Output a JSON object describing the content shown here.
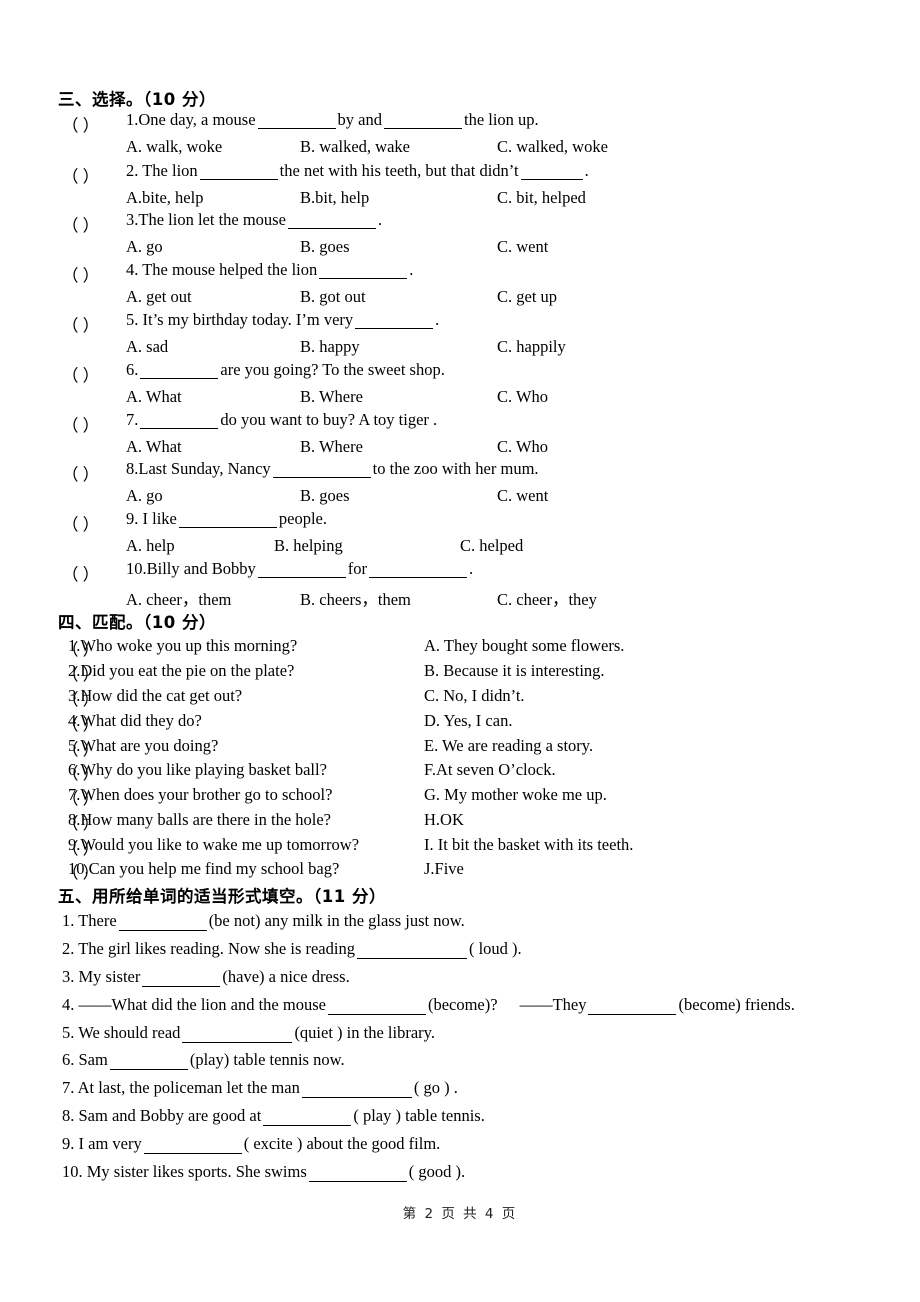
{
  "document": {
    "footer": "第 2 页 共 4 页",
    "page_number": "2",
    "total_pages": "4"
  },
  "section3": {
    "heading": "三、选择。（10 分）",
    "bracket": "（      ）",
    "questions": [
      {
        "number": "1.",
        "stem_pre": "1.One day, a mouse",
        "stem_mid": "by and",
        "stem_post": "the lion up.",
        "optA": "A. walk, woke",
        "optB": "B. walked, wake",
        "optC": "C. walked, woke"
      },
      {
        "number": "2.",
        "stem_pre": "2. The lion",
        "stem_mid": "the net with his teeth, but that didn’t",
        "stem_post": ".",
        "optA": "A.bite, help",
        "optB": "B.bit, help",
        "optC": "C. bit, helped"
      },
      {
        "number": "3.",
        "stem_pre": "3.The lion let the mouse",
        "stem_mid": "",
        "stem_post": ".",
        "optA": "A. go",
        "optB": "B. goes",
        "optC": "C. went"
      },
      {
        "number": "4.",
        "stem_pre": "4. The mouse helped the lion",
        "stem_mid": "",
        "stem_post": ".",
        "optA": "A. get out",
        "optB": "B. got out",
        "optC": "C. get up"
      },
      {
        "number": "5.",
        "stem_pre": "5. It’s my birthday today. I’m very",
        "stem_mid": "",
        "stem_post": ".",
        "optA": "A. sad",
        "optB": "B. happy",
        "optC": "C. happily"
      },
      {
        "number": "6.",
        "stem_pre": "6.",
        "stem_mid": "",
        "stem_post": "are you going?    To the sweet shop.",
        "optA": "A. What",
        "optB": "B. Where",
        "optC": "C. Who"
      },
      {
        "number": "7.",
        "stem_pre": "7.",
        "stem_mid": "",
        "stem_post": "do you want to buy?    A toy tiger .",
        "optA": "A. What",
        "optB": "B. Where",
        "optC": "C. Who"
      },
      {
        "number": "8.",
        "stem_pre": "8.Last Sunday, Nancy",
        "stem_mid": "",
        "stem_post": "to the zoo with her mum.",
        "optA": "A. go",
        "optB": "B. goes",
        "optC": "C. went"
      },
      {
        "number": "9.",
        "stem_pre": "9. I like",
        "stem_mid": "",
        "stem_post": "people.",
        "optA": "A. help",
        "optB": "B. helping",
        "optC": "C. helped"
      },
      {
        "number": "10.",
        "stem_pre": "10.Billy and Bobby",
        "stem_mid": "for",
        "stem_post": ".",
        "optA": "A. cheer，them",
        "optB": "B. cheers，them",
        "optC": "C. cheer，they"
      }
    ]
  },
  "section4": {
    "heading": "四、匹配。（10 分）",
    "bracket": "（      ）",
    "questions": [
      "1.Who woke you up this morning?",
      "2.Did you eat the pie on the plate?",
      "3.How did the cat get out?",
      "4.What did they do?",
      "5.What are you doing?",
      "6.Why do you like playing basket ball?",
      "7.When does your brother go to school?",
      "8.How many balls are there in the hole?",
      "9.Would you like to wake me up tomorrow?",
      "10.Can you help me find my school bag?"
    ],
    "answers": [
      "A. They bought some flowers.",
      " B. Because it is interesting.",
      "C. No, I didn’t.",
      "D. Yes, I can.",
      "E. We are reading a story.",
      " F.At seven O’clock.",
      "G. My mother woke me up.",
      "H.OK",
      " I. It bit the basket with its teeth.",
      "J.Five"
    ]
  },
  "section5": {
    "heading": "五、用所给单词的适当形式填空。（11 分）",
    "items": [
      {
        "pre": "1. There",
        "post": "(be not) any milk in the glass just now.",
        "pre2": "",
        "post2": ""
      },
      {
        "pre": "2. The girl likes reading. Now she is reading",
        "post": "( loud ).",
        "pre2": "",
        "post2": ""
      },
      {
        "pre": "3. My sister",
        "post": "(have) a nice dress.",
        "pre2": "",
        "post2": ""
      },
      {
        "pre": "4. ——What did the lion and the mouse",
        "post": "(become)?",
        "pre2": "——They",
        "post2": "(become) friends."
      },
      {
        "pre": "5. We should read",
        "post": "(quiet ) in the library.",
        "pre2": "",
        "post2": ""
      },
      {
        "pre": "6. Sam",
        "post": "(play) table tennis now.",
        "pre2": "",
        "post2": ""
      },
      {
        "pre": "7. At last, the policeman let the man",
        "post": "( go ) .",
        "pre2": "",
        "post2": ""
      },
      {
        "pre": "8. Sam and Bobby are good at",
        "post": "( play ) table tennis.",
        "pre2": "",
        "post2": ""
      },
      {
        "pre": "9. I am very",
        "post": "( excite ) about the good film.",
        "pre2": "",
        "post2": ""
      },
      {
        "pre": "10. My sister likes sports. She swims",
        "post": "( good ).",
        "pre2": "",
        "post2": ""
      }
    ]
  }
}
